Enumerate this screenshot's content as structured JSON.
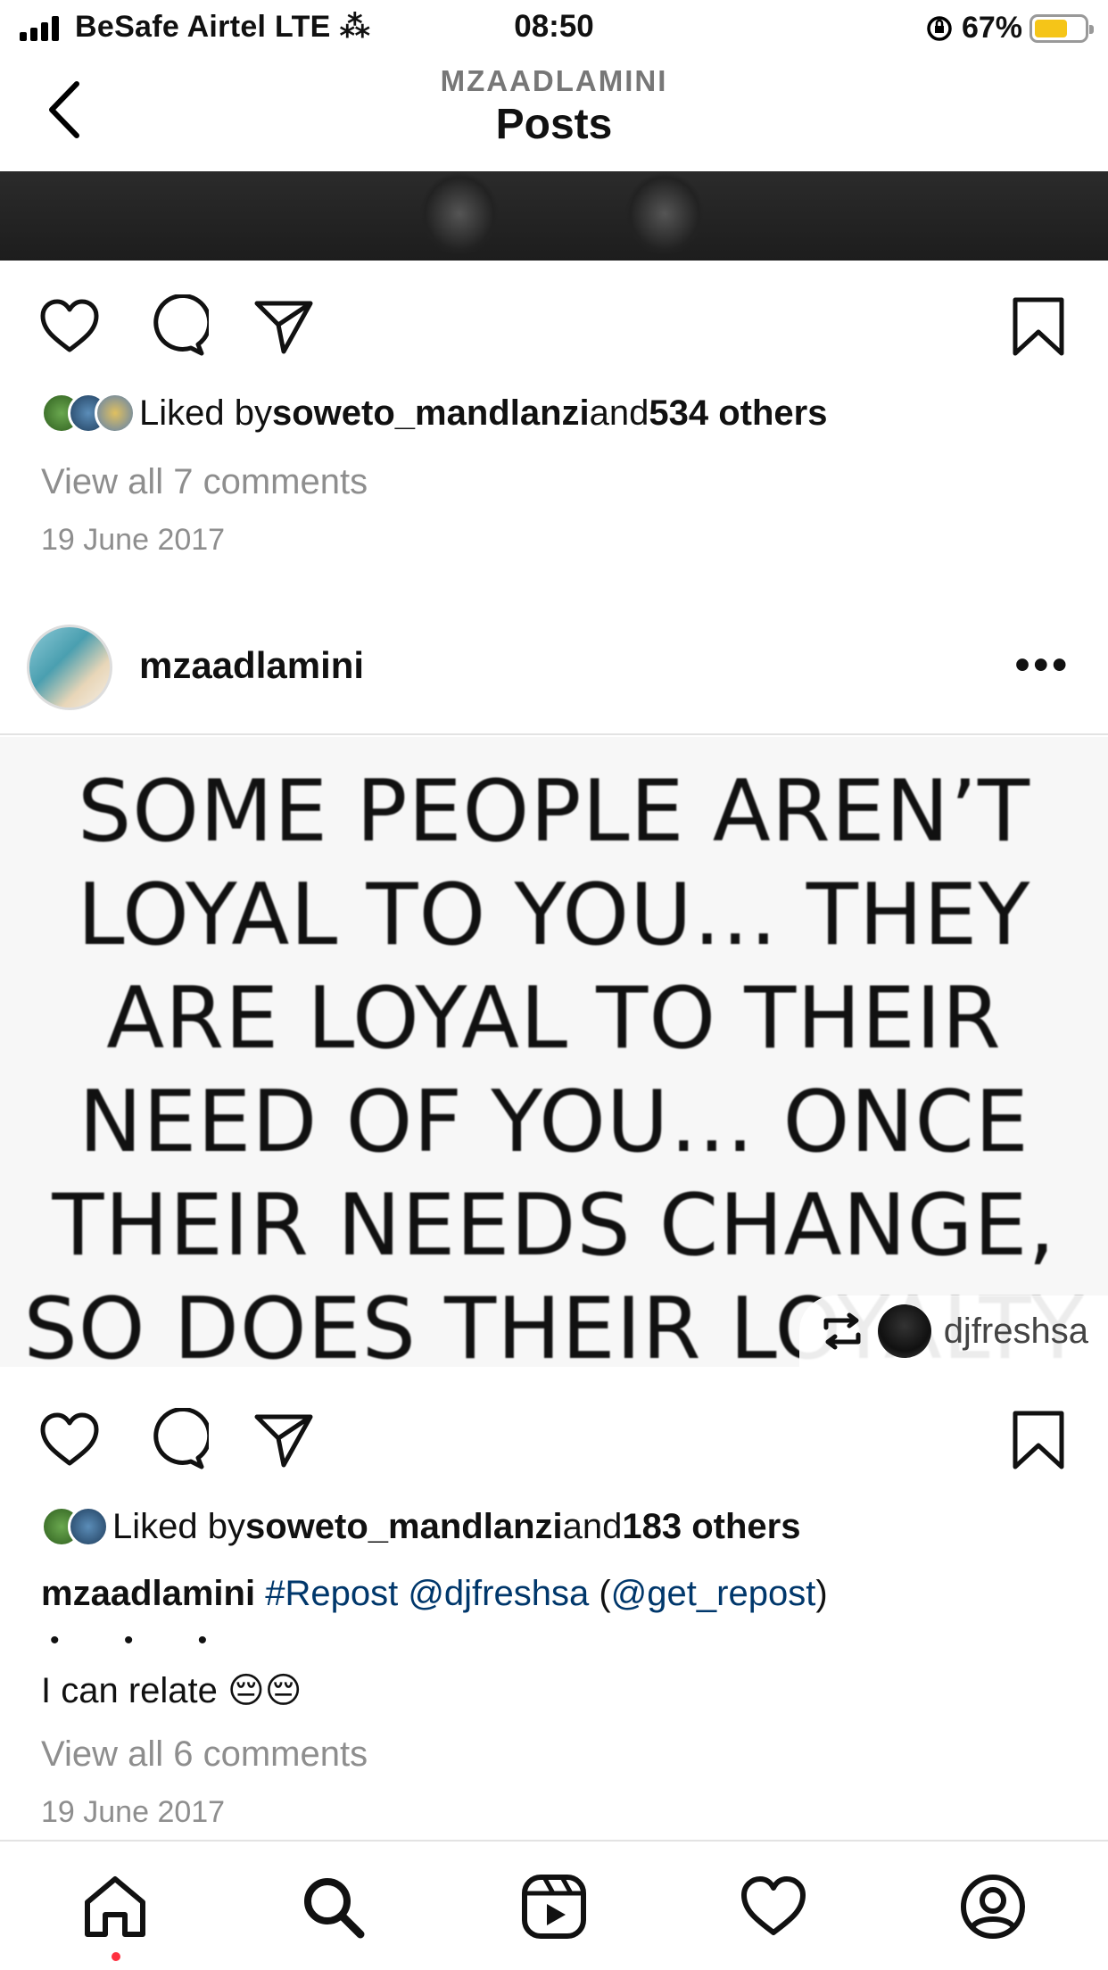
{
  "status_bar": {
    "carrier": "BeSafe Airtel  LTE ⁂",
    "time": "08:50",
    "battery": "67%",
    "battery_level": 0.67
  },
  "header": {
    "username": "MZAADLAMINI",
    "title": "Posts"
  },
  "post1": {
    "liked_by_prefix": "Liked by ",
    "liked_by_user": "soweto_mandlanzi",
    "liked_by_and": " and ",
    "liked_by_others": "534 others",
    "comments_link": "View all 7 comments",
    "date": "19 June 2017"
  },
  "post2": {
    "username": "mzaadlamini",
    "more": "•••",
    "quote_lines": [
      "SOME PEOPLE AREN’T",
      "LOYAL TO YOU… THEY",
      "ARE LOYAL TO THEIR",
      "NEED OF YOU… ONCE",
      "THEIR NEEDS CHANGE,",
      "SO DOES THEIR LOYALTY"
    ],
    "repost_user": "djfreshsa",
    "liked_by_prefix": "Liked by ",
    "liked_by_user": "soweto_mandlanzi",
    "liked_by_and": " and ",
    "liked_by_others": "183 others",
    "caption_user": "mzaadlamini",
    "caption_hashtag": "#Repost",
    "caption_mention": "@djfreshsa",
    "caption_paren_open": " (",
    "caption_mention2": "@get_repost",
    "caption_paren_close": ")",
    "caption_dots": "• • •",
    "caption_text": "I can relate 😔😔",
    "comments_link": "View all 6 comments",
    "date": "19 June 2017"
  },
  "nav": {
    "items": [
      "home-icon",
      "search-icon",
      "reels-icon",
      "activity-icon",
      "profile-icon"
    ]
  }
}
